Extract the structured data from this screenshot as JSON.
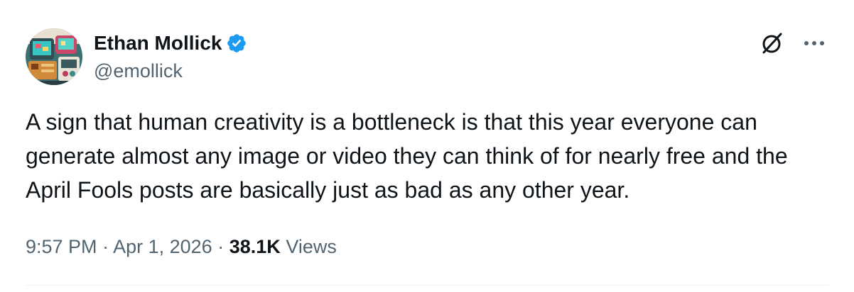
{
  "author": {
    "display_name": "Ethan Mollick",
    "handle": "@emollick",
    "verified": true,
    "avatar_icon": "pixel-art-device-avatar"
  },
  "actions": {
    "grok_icon": "grok-icon",
    "more_icon": "more-options-icon"
  },
  "tweet": {
    "text": "A sign that human creativity is a bottleneck is that this year everyone can generate almost any image or video they can think of for nearly free and the April Fools posts are basically just as bad as any other year."
  },
  "meta": {
    "time": "9:57 PM",
    "separator": "·",
    "date": "Apr 1, 2026",
    "views_count": "38.1K",
    "views_label": "Views"
  },
  "colors": {
    "text_primary": "#0f1419",
    "text_secondary": "#536471",
    "verified_blue": "#1d9bf0",
    "divider": "#eff3f4"
  }
}
